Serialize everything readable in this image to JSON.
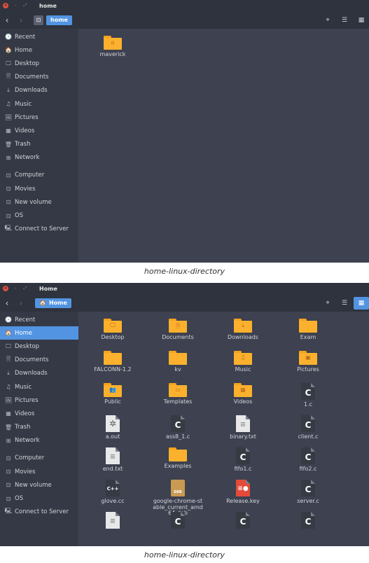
{
  "window1": {
    "title": "home",
    "crumb": "home",
    "sidebar": [
      {
        "label": "Recent",
        "icon": "clock-icon",
        "glyph": "🕓"
      },
      {
        "label": "Home",
        "icon": "home-icon",
        "glyph": "🏠"
      },
      {
        "label": "Desktop",
        "icon": "desktop-icon",
        "glyph": "🖵"
      },
      {
        "label": "Documents",
        "icon": "document-icon",
        "glyph": "🗎"
      },
      {
        "label": "Downloads",
        "icon": "download-icon",
        "glyph": "⤓"
      },
      {
        "label": "Music",
        "icon": "music-icon",
        "glyph": "♫"
      },
      {
        "label": "Pictures",
        "icon": "picture-icon",
        "glyph": "🖼"
      },
      {
        "label": "Videos",
        "icon": "film-icon",
        "glyph": "▦"
      },
      {
        "label": "Trash",
        "icon": "trash-icon",
        "glyph": "🗑"
      },
      {
        "label": "Network",
        "icon": "network-icon",
        "glyph": "⊞"
      },
      {
        "label": "Computer",
        "icon": "drive-icon",
        "glyph": "⊡"
      },
      {
        "label": "Movies",
        "icon": "drive-icon",
        "glyph": "⊡"
      },
      {
        "label": "New volume",
        "icon": "drive-icon",
        "glyph": "⊡"
      },
      {
        "label": "OS",
        "icon": "drive-icon",
        "glyph": "⊡"
      },
      {
        "label": "Connect to Server",
        "icon": "server-icon",
        "glyph": "🖳"
      }
    ],
    "files": [
      {
        "label": "maverick",
        "type": "folder",
        "emblem": "⌂"
      }
    ],
    "caption": "home-linux-directory"
  },
  "window2": {
    "title": "Home",
    "crumb": "Home",
    "selected_sidebar": "Home",
    "sidebar": [
      {
        "label": "Recent",
        "icon": "clock-icon",
        "glyph": "🕓"
      },
      {
        "label": "Home",
        "icon": "home-icon",
        "glyph": "🏠"
      },
      {
        "label": "Desktop",
        "icon": "desktop-icon",
        "glyph": "🖵"
      },
      {
        "label": "Documents",
        "icon": "document-icon",
        "glyph": "🗎"
      },
      {
        "label": "Downloads",
        "icon": "download-icon",
        "glyph": "⤓"
      },
      {
        "label": "Music",
        "icon": "music-icon",
        "glyph": "♫"
      },
      {
        "label": "Pictures",
        "icon": "picture-icon",
        "glyph": "🖼"
      },
      {
        "label": "Videos",
        "icon": "film-icon",
        "glyph": "▦"
      },
      {
        "label": "Trash",
        "icon": "trash-icon",
        "glyph": "🗑"
      },
      {
        "label": "Network",
        "icon": "network-icon",
        "glyph": "⊞"
      },
      {
        "label": "Computer",
        "icon": "drive-icon",
        "glyph": "⊡"
      },
      {
        "label": "Movies",
        "icon": "drive-icon",
        "glyph": "⊡"
      },
      {
        "label": "New volume",
        "icon": "drive-icon",
        "glyph": "⊡"
      },
      {
        "label": "OS",
        "icon": "drive-icon",
        "glyph": "⊡"
      },
      {
        "label": "Connect to Server",
        "icon": "server-icon",
        "glyph": "🖳"
      }
    ],
    "files": [
      {
        "label": "Desktop",
        "type": "folder",
        "emblem": "🖵"
      },
      {
        "label": "Documents",
        "type": "folder",
        "emblem": "🗎"
      },
      {
        "label": "Downloads",
        "type": "folder",
        "emblem": "⤓"
      },
      {
        "label": "Exam",
        "type": "folder",
        "emblem": ""
      },
      {
        "label": "FALCONN-1.2",
        "type": "folder",
        "emblem": ""
      },
      {
        "label": "kv",
        "type": "folder",
        "emblem": ""
      },
      {
        "label": "Music",
        "type": "folder",
        "emblem": "♫"
      },
      {
        "label": "Pictures",
        "type": "folder",
        "emblem": "▣"
      },
      {
        "label": "Public",
        "type": "folder",
        "emblem": "👥"
      },
      {
        "label": "Templates",
        "type": "folder",
        "emblem": "▭"
      },
      {
        "label": "Videos",
        "type": "folder",
        "emblem": "▦"
      },
      {
        "label": "1.c",
        "type": "c",
        "emblem": "C"
      },
      {
        "label": "a.out",
        "type": "exec",
        "emblem": "✲"
      },
      {
        "label": "ass8_1.c",
        "type": "c",
        "emblem": "C"
      },
      {
        "label": "binary.txt",
        "type": "txt",
        "emblem": "≡"
      },
      {
        "label": "client.c",
        "type": "c",
        "emblem": "C"
      },
      {
        "label": "end.txt",
        "type": "txt",
        "emblem": "≡"
      },
      {
        "label": "Examples",
        "type": "folder",
        "emblem": ""
      },
      {
        "label": "fifo1.c",
        "type": "c",
        "emblem": "C"
      },
      {
        "label": "fifo2.c",
        "type": "c",
        "emblem": "C"
      },
      {
        "label": "glove.cc",
        "type": "cpp",
        "emblem": "C++"
      },
      {
        "label": "google-chrome-stable_current_amd64.deb",
        "type": "deb",
        "emblem": "DEB"
      },
      {
        "label": "Release.key",
        "type": "key",
        "emblem": "≡●"
      },
      {
        "label": "server.c",
        "type": "c",
        "emblem": "C"
      },
      {
        "label": "",
        "type": "txt",
        "emblem": "≡"
      },
      {
        "label": "",
        "type": "c",
        "emblem": "C"
      },
      {
        "label": "",
        "type": "c",
        "emblem": "C"
      },
      {
        "label": "",
        "type": "c",
        "emblem": "C"
      }
    ],
    "caption": "home-linux-directory"
  },
  "toolbar": {
    "back": "‹",
    "forward": "›",
    "location_glyph": "⌖",
    "list_glyph": "☰",
    "grid_glyph": "▦"
  },
  "colors": {
    "accent": "#5294e2",
    "folder": "#fbb12d",
    "bg": "#3d4150",
    "sidebar": "#353945"
  }
}
